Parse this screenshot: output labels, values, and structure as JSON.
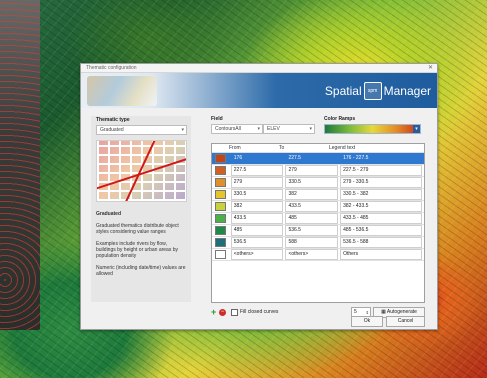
{
  "window": {
    "title": "Thematic configuration",
    "close": "✕"
  },
  "brand": {
    "name_left": "Spatial",
    "logo_text": "spm",
    "name_right": "Manager"
  },
  "thematic": {
    "label": "Thematic type",
    "value": "Graduated"
  },
  "field": {
    "label": "Field",
    "value_left": "ContoursAll",
    "value_right": "ELEV"
  },
  "color_ramps": {
    "label": "Color Ramps",
    "colors": [
      "#1f7a3b",
      "#79b93b",
      "#e7d83b",
      "#e58b24",
      "#c7301e"
    ]
  },
  "info": {
    "heading": "Graduated",
    "p1": "Graduated thematics distribute object styles considering value ranges",
    "p2": "Examples include rivers by flow, buildings by height or urban areas by population density",
    "p3": "Numeric (including date/time) values are allowed"
  },
  "grid": {
    "headers": {
      "from": "From",
      "to": "To",
      "legend": "Legend text"
    },
    "rows": [
      {
        "color": "#c0451d",
        "from": "176",
        "to": "227.5",
        "legend": "176 - 227.5",
        "selected": true
      },
      {
        "color": "#cf5f23",
        "from": "227.5",
        "to": "279",
        "legend": "227.5 - 279"
      },
      {
        "color": "#e0902b",
        "from": "279",
        "to": "330.5",
        "legend": "279 - 330.5"
      },
      {
        "color": "#e5c62a",
        "from": "330.5",
        "to": "382",
        "legend": "330.5 - 382"
      },
      {
        "color": "#c8d23a",
        "from": "382",
        "to": "433.5",
        "legend": "382 - 433.5"
      },
      {
        "color": "#4ab04a",
        "from": "433.5",
        "to": "485",
        "legend": "433.5 - 485"
      },
      {
        "color": "#1f8a48",
        "from": "485",
        "to": "536.5",
        "legend": "485 - 536.5"
      },
      {
        "color": "#1f6f7a",
        "from": "536.5",
        "to": "588",
        "legend": "536.5 - 588"
      },
      {
        "color": "#ffffff",
        "from": "<others>",
        "to": "<others>",
        "legend": "Others"
      }
    ]
  },
  "controls": {
    "add": "+",
    "remove": "−",
    "fill_label": "Fill closed curves",
    "steps_value": "5",
    "autogenerate": "Autogenerate",
    "ok": "Ok",
    "cancel": "Cancel"
  }
}
